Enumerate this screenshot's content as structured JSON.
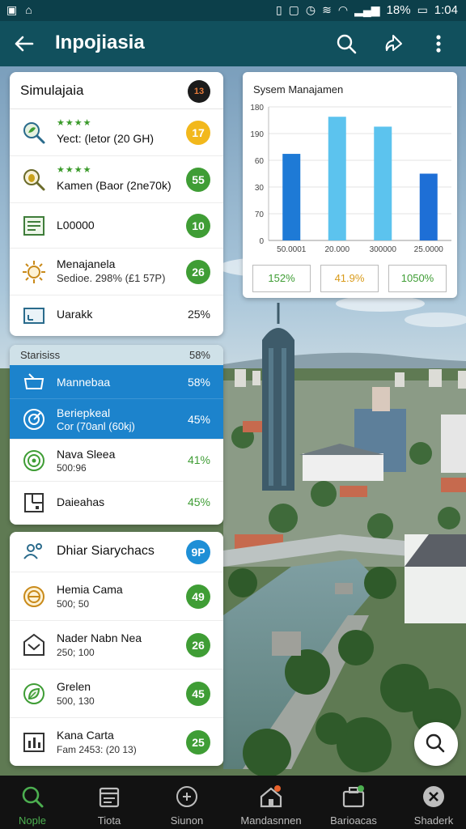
{
  "status_bar": {
    "battery": "18%",
    "time": "1:04"
  },
  "app_bar": {
    "title": "Inpojiasia"
  },
  "sim_card": {
    "title": "Simulajaia",
    "badge": "13",
    "rows": [
      {
        "stars": "★★★★",
        "label": "Yect: (letor (20 GH)",
        "value": "17",
        "color": "#f2b81c",
        "icon": "search-leaf-icon"
      },
      {
        "stars": "★★★★",
        "label": "Kamen (Baor (2ne70k)",
        "value": "55",
        "color": "#3f9d35",
        "icon": "bug-search-icon"
      },
      {
        "label": "L00000",
        "value": "10",
        "color": "#3f9d35",
        "icon": "document-list-icon"
      },
      {
        "label": "Menajanela",
        "sub": "Sedioe. 298% (£1 57P)",
        "value": "26",
        "color": "#3f9d35",
        "icon": "sun-gear-icon"
      },
      {
        "label": "Uarakk",
        "pct": "25%",
        "icon": "window-icon"
      }
    ]
  },
  "chart_card": {
    "title": "Sysem Manajamen",
    "summaries": [
      {
        "text": "152%",
        "color": "#3f9d35"
      },
      {
        "text": "41.9%",
        "color": "#d99b1a"
      },
      {
        "text": "1050%",
        "color": "#3f9d35"
      }
    ]
  },
  "chart_data": {
    "type": "bar",
    "title": "Sysem Manajamen",
    "xlabel": "",
    "ylabel": "",
    "ytick_labels": [
      "0",
      "70",
      "30",
      "60",
      "190",
      "180"
    ],
    "xtick_labels": [
      "50.0001",
      "20.000",
      "300000",
      "25.0000"
    ],
    "values": [
      35,
      50,
      46,
      27
    ],
    "bar_colors": [
      "#1e7ad6",
      "#5cc3ee",
      "#5cc3ee",
      "#1e6fd6"
    ],
    "ylim": [
      0,
      54
    ],
    "grid": "horizontal"
  },
  "stats_card": {
    "title": "Starisiss",
    "pct": "58%",
    "rows": [
      {
        "label": "Mannebaa",
        "pct": "58%",
        "active": true,
        "icon": "tray-icon"
      },
      {
        "label": "Beriepkeal",
        "sub": "Cor (70anl (60kj)",
        "pct": "45%",
        "active": true,
        "icon": "radar-icon"
      },
      {
        "label": "Nava Sleea",
        "sub": "500:96",
        "pct": "41%",
        "pct_color": "#3f9d35",
        "icon": "target-icon"
      },
      {
        "label": "Daieahas",
        "pct": "45%",
        "pct_color": "#3f9d35",
        "icon": "grid-doc-icon"
      }
    ]
  },
  "list_card": {
    "rows": [
      {
        "label": "Dhiar Siarychacs",
        "value": "9P",
        "color": "#1e8fd6",
        "icon": "people-icon"
      },
      {
        "label": "Hemia Cama",
        "sub": "500; 50",
        "value": "49",
        "color": "#3f9d35",
        "icon": "compass-icon"
      },
      {
        "label": "Nader Nabn Nea",
        "sub": "250; 100",
        "value": "26",
        "color": "#3f9d35",
        "icon": "mail-gear-icon"
      },
      {
        "label": "Grelen",
        "sub": "500, 130",
        "value": "45",
        "color": "#3f9d35",
        "icon": "leaf-icon"
      },
      {
        "label": "Kana Carta",
        "sub": "Fam 2453: (20 13)",
        "value": "25",
        "color": "#3f9d35",
        "icon": "chart-box-icon"
      }
    ]
  },
  "bottom_nav": [
    {
      "label": "Nople",
      "icon": "search-icon",
      "active": true
    },
    {
      "label": "Tiota",
      "icon": "calendar-icon"
    },
    {
      "label": "Siunon",
      "icon": "plus-circle-icon"
    },
    {
      "label": "Mandasnnen",
      "icon": "home-icon"
    },
    {
      "label": "Barioacas",
      "icon": "briefcase-icon"
    },
    {
      "label": "Shaderk",
      "icon": "close-circle-icon"
    }
  ]
}
